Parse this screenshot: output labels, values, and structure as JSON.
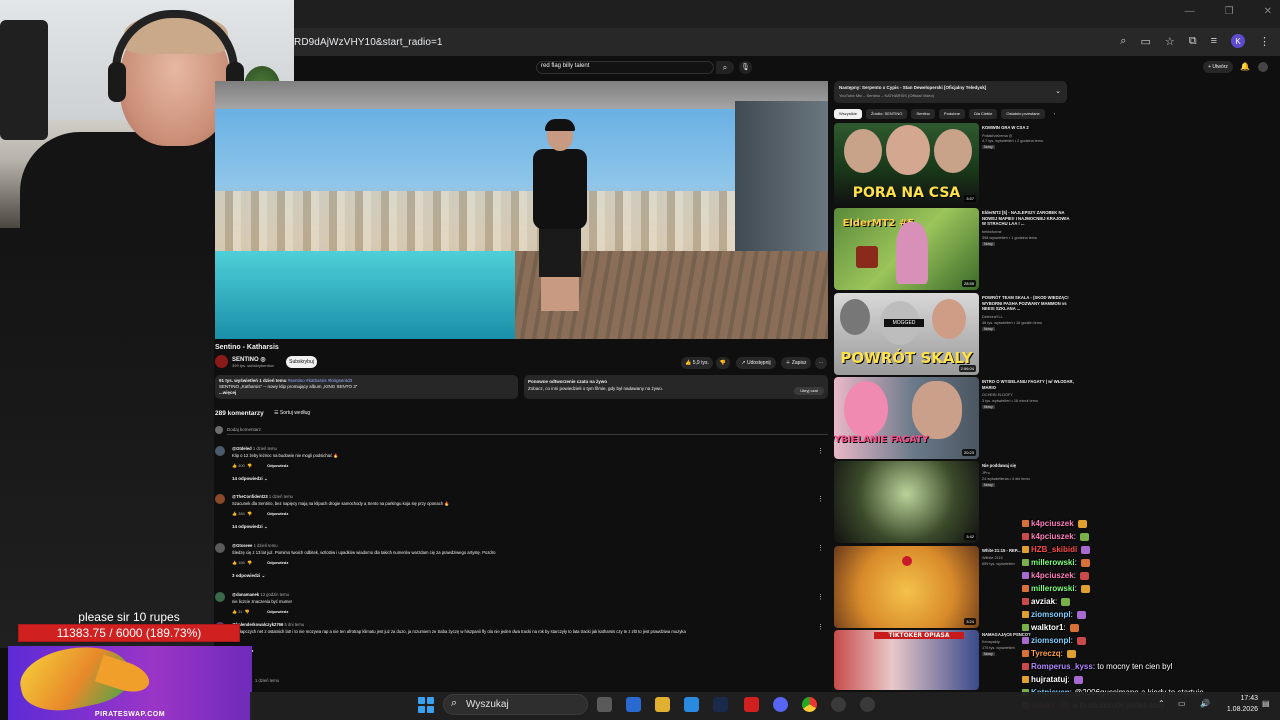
{
  "browser": {
    "url_fragment": "RD9dAjWzVHY10&start_radio=1"
  },
  "overlay": {
    "donation_message": "please sir 10 rupes",
    "donation_progress": "11383.75 / 6000 (189.73%)",
    "donation_fraction": 1.0,
    "promo_label": "PIRATESWAP.COM"
  },
  "youtube": {
    "search_query": "red flag billy talent",
    "create_label": "+ Utwórz",
    "video": {
      "title": "Sentino - Katharsis",
      "channel": "SENTINO ◎",
      "subscribers": "399 tys. subskrybentów",
      "subscribe_label": "Subskrybuj",
      "likes": "5,9 tys.",
      "share_label": "Udostępnij",
      "save_label": "Zapisz",
      "description_meta": "91 tys. wyświetleń  1 dzień temu",
      "description_tags": "#sentino #katharsis #kingsentd3",
      "description_line2": "SENTINO „Katharsis” -- nowy klip promujący album „KING SENTO 3”",
      "description_more": "...więcej",
      "live_title": "Ponowne odtworzenie czatu na żywo",
      "live_text": "Zobacz, co inni powiedzieli o tym filmie, gdy był nadawany na żywo.",
      "live_button": "Ukryj czat"
    },
    "comments": {
      "count_label": "289 komentarzy",
      "sort_label": "Sortuj według",
      "add_placeholder": "Dodaj komentarz",
      "reply_label": "Odpowiedz",
      "items": [
        {
          "author": "@Gtdeled",
          "time": "1 dzień temu",
          "text": "Klip o 12 żeby leżnoc na budowie nie mogli podsichać 🔥",
          "likes": "400",
          "replies": "14 odpowiedzi"
        },
        {
          "author": "@TheConfident23",
          "time": "1 dzień temu",
          "text": "Szacunek dla Sentino, bez napięcy mają na klipach drogie samochody a Sento na parkingu koja się przy oponach 🔥",
          "likes": "384",
          "replies": "14 odpowiedzi"
        },
        {
          "author": "@Gtsseee",
          "time": "1 dzień temu",
          "text": "Śledzę cię z 13 lat już. Pomimo twoich odbitek, wzlotów i upadków wiadomo dla takich numerów warzdam cię za prawdziwego artystę. Pozdro",
          "likes": "166",
          "replies": "3 odpowiedzi"
        },
        {
          "author": "@danamanek",
          "time": "13 godzin temu",
          "text": "nie liczcie znaczenia być mumer",
          "likes": "31",
          "replies": ""
        },
        {
          "author": "@kalenderkowalczyk2766",
          "time": "5 dni temu",
          "text": "to z łapczych net z ostatnich lat! i to nie mozywa rap a nie ten afrotrap klimatu jest już za duzo, ja rozumiem ze Saba życzę w hiszpanii fly ola nie jeden dwa tracki na rok by starczyły to lata tracki jak katharsis czy te z zł3 to jest prawdziwa muzyka",
          "likes": "",
          "replies": ""
        },
        {
          "author": "",
          "time": "1 dzień temu",
          "text": "",
          "likes": "",
          "replies": ""
        }
      ]
    },
    "sidebar": {
      "next_up_title": "Następny: Serpento x Cypis - Stan Deweloperski [Oficjalny Teledysk]",
      "next_up_channel": "YouTube Mix – Sentino – KATHARSIS (Official Video)",
      "chips": [
        "Wszystkie",
        "Źródło: SENTINO",
        "Sentino",
        "Podobne",
        "Dla Ciebie",
        "Ostatnio przesłane"
      ],
      "videos": [
        {
          "title": "KOMWIN GRA W CSA 2",
          "channel": "PollakhaKrema ◎",
          "meta": "4,7 tys. wyświetleń • 2 godzina temu",
          "badge": "Nowy",
          "duration": "3:57",
          "caption": "PORA NA CSA"
        },
        {
          "title": "ElderMT2 [5] - NAJLEPSZY ZAROBEK NA NOWEJ MAPIE!! I NAJMOCNIEJ KRAJOWIA W STRACHU LAA ! ...",
          "channel": "bebiwforme",
          "meta": "398 wyświetleń • 1 godzina temu",
          "badge": "Nowy",
          "duration": "28:59",
          "caption": "ElderMT2 #5"
        },
        {
          "title": "POWRÓT TEAM SKALA - (SKOD WIEDZĄC! WYBORNI PASHA POZWANY MAMMON vs NEEXI SZKLANA ...",
          "channel": "DzieloraYLL",
          "meta": "46 tys. wyświetleń • 16 godzin temu",
          "badge": "Nowy",
          "duration": "2:56:04",
          "caption": "POWRÓT SKALY"
        },
        {
          "title": "INTRO O WYSIELANIU FAGATY | w/ WŁODAR, MARIO",
          "channel": "OCHEBI ELDOFY",
          "meta": "3 tys. wyświetleń • 16 minut temu",
          "badge": "Nowy",
          "duration": "20:23",
          "caption": "WYBIELANIE FAGATY"
        },
        {
          "title": "Nie poddawaj się",
          "channel": "JPro",
          "meta": "24 wyświetlenia • 4 dni temu",
          "badge": "Nowy",
          "duration": "3:42",
          "caption": ""
        },
        {
          "title": "White 21:15 - REP...",
          "channel": "Wilhite 2115",
          "meta": "659 tys. wyświetleń",
          "badge": "",
          "duration": "3:24",
          "caption": ""
        },
        {
          "title": "NAMAGAJĄCE PSNCO?",
          "channel": "Kenspakty",
          "meta": "175 tys. wyświetleń",
          "badge": "Nowy",
          "duration": "",
          "caption": "TIKTOKER OPIASA"
        }
      ]
    }
  },
  "chat": {
    "messages": [
      {
        "user": "k4pciuszek",
        "text": "",
        "color": "#ff7fbf"
      },
      {
        "user": "k4pciuszek",
        "text": ":",
        "color": "#ff7fbf"
      },
      {
        "user": "HZB_skibidi",
        "text": "",
        "color": "#ff4a4a"
      },
      {
        "user": "millerowski",
        "text": ":",
        "color": "#7dff7d"
      },
      {
        "user": "k4pciuszek",
        "text": ":",
        "color": "#ff7fbf"
      },
      {
        "user": "millerowski",
        "text": ":",
        "color": "#7dff7d"
      },
      {
        "user": "avziak",
        "text": ":",
        "color": "#ffffff"
      },
      {
        "user": "ziomsonpl",
        "text": ":",
        "color": "#7fd0ff"
      },
      {
        "user": "walktor1",
        "text": ":",
        "color": "#ffffff"
      },
      {
        "user": "ziomsonpl",
        "text": ":",
        "color": "#7fd0ff"
      },
      {
        "user": "Tyreczq",
        "text": ":",
        "color": "#ff9f43"
      },
      {
        "user": "Romperus_kyss",
        "text": ": to mocny ten cien byl",
        "color": "#b388ff"
      },
      {
        "user": "hujratatuj",
        "text": ":",
        "color": "#ffffff"
      },
      {
        "user": "Kotpieven",
        "text": ": @2006guccimane a kiedy to startuje",
        "color": "#7fd0ff"
      },
      {
        "user": "Stiv6T_69",
        "text": ": a to chudziutki jesteś sory",
        "color": "#ff6b6b"
      }
    ]
  },
  "taskbar": {
    "search_label": "Wyszukaj",
    "time": "17:43",
    "date": "1.08.2026"
  },
  "colors": {
    "yt_bg": "#0f0f0f",
    "donation_red": "#d12020",
    "promo_purple": "#7a2fd0"
  }
}
